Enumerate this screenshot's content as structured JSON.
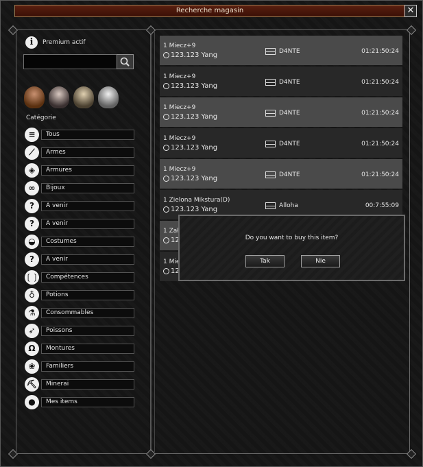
{
  "window": {
    "title": "Recherche magasin",
    "close_label": "✕"
  },
  "sidebar": {
    "premium_label": "Premium actif",
    "search": {
      "value": "",
      "placeholder": ""
    },
    "category_title": "Catégorie",
    "categories": [
      {
        "label": "Tous",
        "icon": "list-icon",
        "glyph": "≡"
      },
      {
        "label": "Armes",
        "icon": "sword-icon",
        "glyph": "⟋"
      },
      {
        "label": "Armures",
        "icon": "shield-icon",
        "glyph": "◈"
      },
      {
        "label": "Bijoux",
        "icon": "rings-icon",
        "glyph": "∞"
      },
      {
        "label": "A venir",
        "icon": "question-icon",
        "glyph": "?"
      },
      {
        "label": "A venir",
        "icon": "question-icon",
        "glyph": "?"
      },
      {
        "label": "Costumes",
        "icon": "mask-icon",
        "glyph": "◒"
      },
      {
        "label": "A venir",
        "icon": "question-icon",
        "glyph": "?"
      },
      {
        "label": "Compétences",
        "icon": "skills-icon",
        "glyph": "❲❳"
      },
      {
        "label": "Potions",
        "icon": "potion-icon",
        "glyph": "♁"
      },
      {
        "label": "Consommables",
        "icon": "flask-icon",
        "glyph": "⚗"
      },
      {
        "label": "Poissons",
        "icon": "fish-icon",
        "glyph": "➶"
      },
      {
        "label": "Montures",
        "icon": "horseshoe-icon",
        "glyph": "Ω"
      },
      {
        "label": "Familiers",
        "icon": "paw-icon",
        "glyph": "❀"
      },
      {
        "label": "Minerai",
        "icon": "pickaxe-icon",
        "glyph": "⛏"
      },
      {
        "label": "Mes items",
        "icon": "user-icon",
        "glyph": "●"
      }
    ]
  },
  "listings": [
    {
      "name": "1 Miecz+9",
      "price": "123.123 Yang",
      "seller": "D4NTE",
      "time": "01:21:50:24"
    },
    {
      "name": "1 Miecz+9",
      "price": "123.123 Yang",
      "seller": "D4NTE",
      "time": "01:21:50:24"
    },
    {
      "name": "1 Miecz+9",
      "price": "123.123 Yang",
      "seller": "D4NTE",
      "time": "01:21:50:24"
    },
    {
      "name": "1 Miecz+9",
      "price": "123.123 Yang",
      "seller": "D4NTE",
      "time": "01:21:50:24"
    },
    {
      "name": "1 Miecz+9",
      "price": "123.123 Yang",
      "seller": "D4NTE",
      "time": "01:21:50:24"
    },
    {
      "name": "1 Zielona Mikstura(D)",
      "price": "123.123 Yang",
      "seller": "Alloha",
      "time": "00:7:55:09"
    },
    {
      "name": "1 Zał",
      "price": "12",
      "seller": "",
      "time": ""
    },
    {
      "name": "1 Mie",
      "price": "12",
      "seller": "",
      "time": ""
    }
  ],
  "dialog": {
    "message": "Do you want to buy this item?",
    "confirm": "Tak",
    "cancel": "Nie"
  }
}
